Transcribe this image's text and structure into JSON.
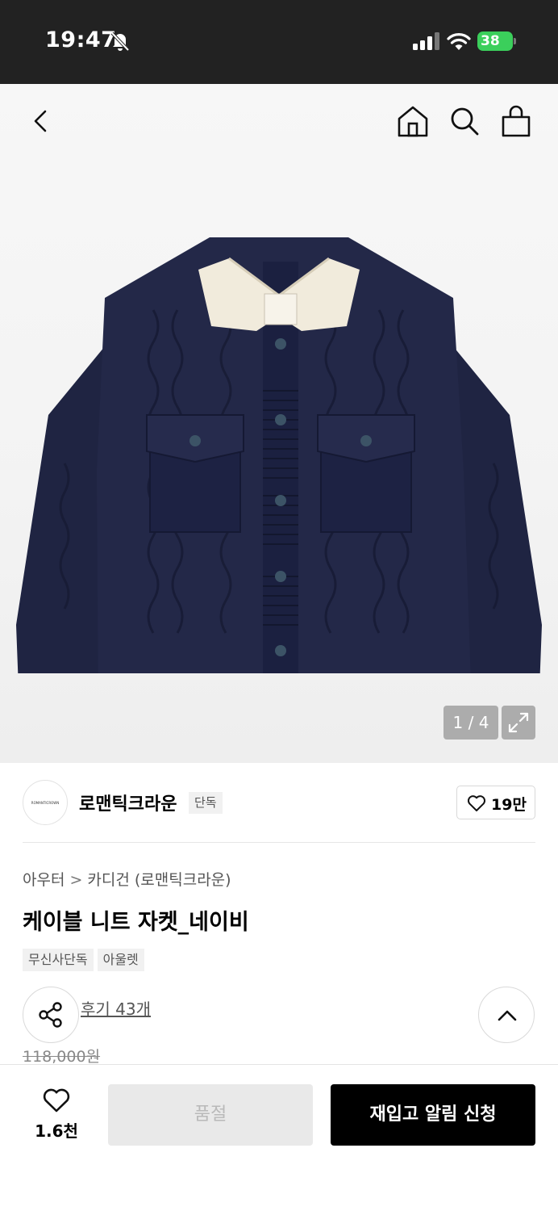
{
  "status_bar": {
    "time": "19:47",
    "battery": "38"
  },
  "header": {
    "icons": [
      "back-arrow-icon",
      "home-icon",
      "search-icon",
      "shopping-bag-icon"
    ]
  },
  "gallery": {
    "current": 1,
    "total": 4,
    "counter_text": "1 / 4",
    "product_colors": {
      "body": "#1f2442",
      "ribbing": "#f1ebdc",
      "stripe": "#7e2430"
    }
  },
  "brand": {
    "logo_text": "ROMANTICROWN",
    "name": "로맨틱크라운",
    "badge": "단독",
    "likes": "19만"
  },
  "product": {
    "breadcrumb": [
      "아우터",
      "카디건 (로맨틱크라운)"
    ],
    "breadcrumb_separator": ">",
    "title": "케이블 니트 자켓_네이비",
    "tags": [
      "무신사단독",
      "아울렛"
    ],
    "review_link": "후기 43개",
    "original_price": "118,000원"
  },
  "action_bar": {
    "wish_count": "1.6천",
    "soldout_label": "품절",
    "restock_label": "재입고 알림 신청"
  }
}
